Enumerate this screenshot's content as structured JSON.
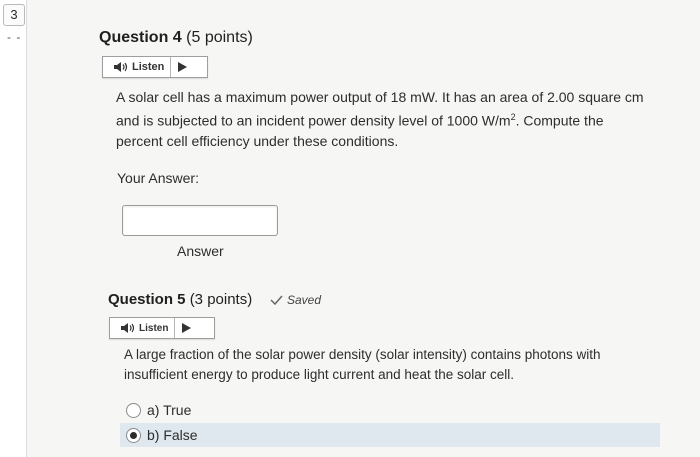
{
  "sidebar": {
    "question_number": "3",
    "dash": "- -"
  },
  "q4": {
    "title": "Question 4",
    "points": "(5 points)",
    "listen_label": "Listen",
    "text_line1": "A solar cell has a maximum power output of 18 mW. It has an area of 2.00 square cm",
    "text_line2_a": "and is subjected to an incident power density level of 1000 W/m",
    "text_line2_sup": "2",
    "text_line2_b": ". Compute the",
    "text_line3": "percent cell efficiency under these conditions.",
    "your_answer_label": "Your Answer:",
    "answer_input_value": "",
    "answer_caption": "Answer"
  },
  "q5": {
    "title": "Question 5",
    "points": "(3 points)",
    "saved_label": "Saved",
    "listen_label": "Listen",
    "text_line1": "A large fraction of the solar power density (solar intensity) contains photons with",
    "text_line2": "insufficient energy to produce light current and heat the solar cell.",
    "options": [
      {
        "label": "a) True",
        "selected": false
      },
      {
        "label": "b) False",
        "selected": true
      }
    ]
  },
  "icons": {
    "speaker": "speaker-icon",
    "play": "play-icon",
    "check": "check-icon"
  },
  "colors": {
    "selected_bg": "#dfe7ef",
    "page_bg": "#f6f6f4"
  }
}
